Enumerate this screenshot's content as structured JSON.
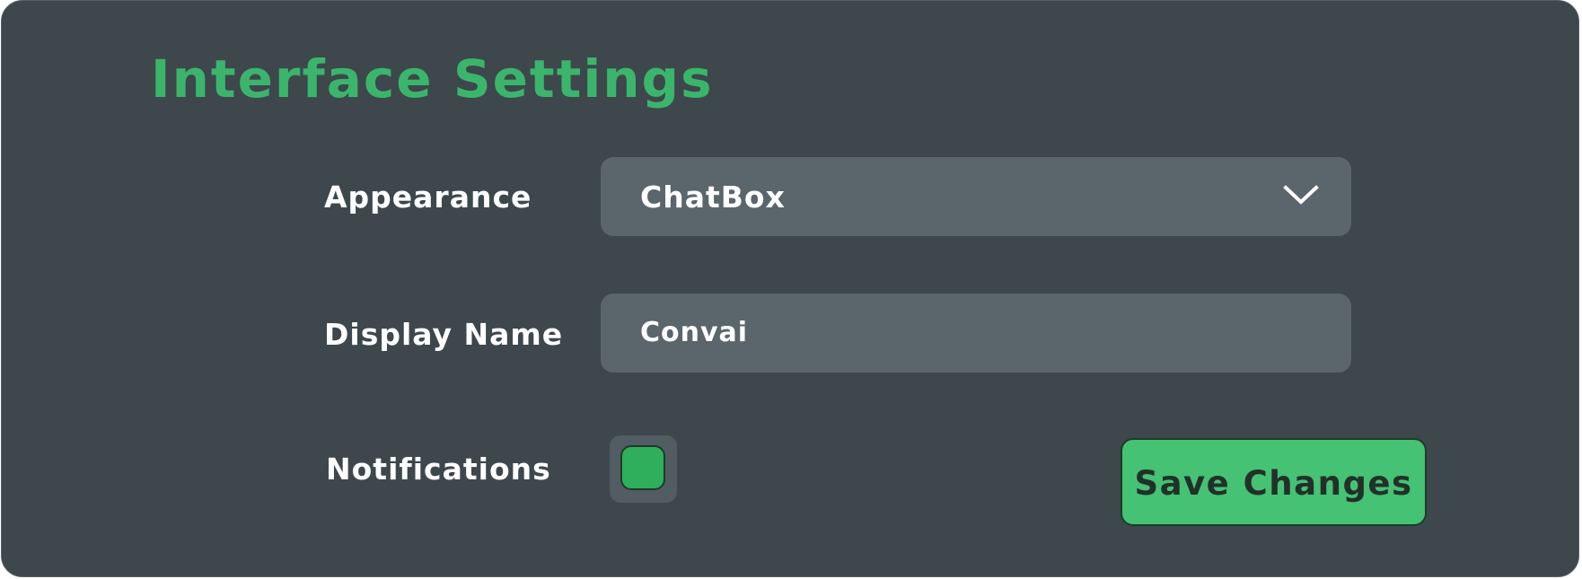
{
  "panel": {
    "title": "Interface Settings"
  },
  "appearance": {
    "label": "Appearance",
    "selected": "ChatBox",
    "icon": "chevron-down-icon"
  },
  "display_name": {
    "label": "Display Name",
    "value": "Convai"
  },
  "notifications": {
    "label": "Notifications",
    "checked": true
  },
  "actions": {
    "save_label": "Save Changes"
  },
  "colors": {
    "accent": "#3bb56c",
    "checkbox_fill": "#2fae5b",
    "button_fill": "#45c274",
    "panel_bg": "#3d474c",
    "field_bg": "#5a656c"
  }
}
